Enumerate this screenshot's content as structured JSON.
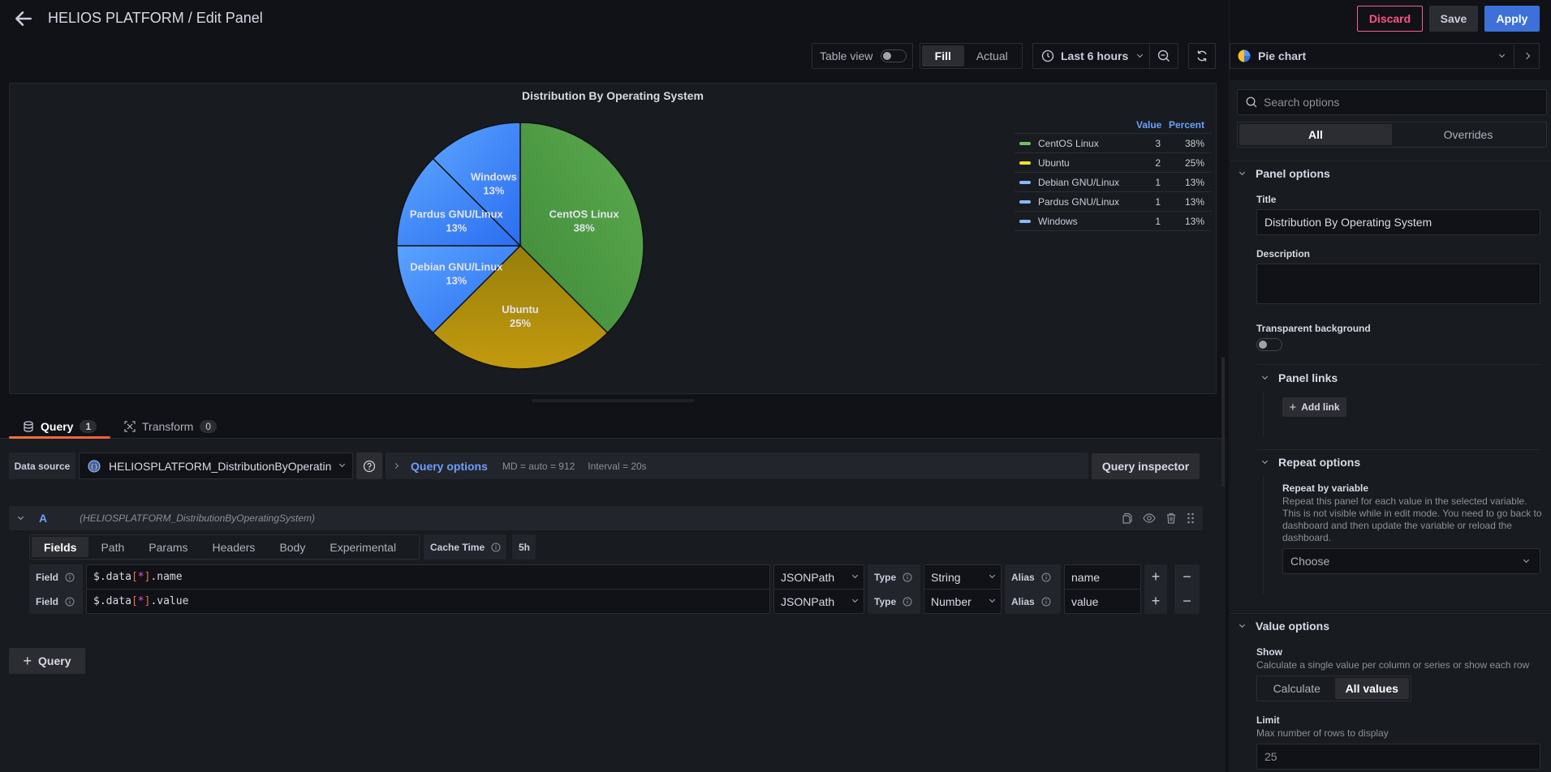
{
  "header": {
    "title": "HELIOS PLATFORM / Edit Panel",
    "discard_label": "Discard",
    "save_label": "Save",
    "apply_label": "Apply"
  },
  "toolbar": {
    "table_view_label": "Table view",
    "table_view_on": false,
    "fill_label": "Fill",
    "actual_label": "Actual",
    "fill_mode_selected": "Fill",
    "time_range": "Last 6 hours",
    "visualization": "Pie chart"
  },
  "panel": {
    "title": "Distribution By Operating System",
    "legend": {
      "value_header": "Value",
      "percent_header": "Percent"
    }
  },
  "chart_data": {
    "type": "pie",
    "title": "Distribution By Operating System",
    "legend_placement": "right",
    "slices": [
      {
        "name": "CentOS Linux",
        "value": 3,
        "percent": "38%",
        "color": "#56a64b"
      },
      {
        "name": "Ubuntu",
        "value": 2,
        "percent": "25%",
        "color": "#c49c0c"
      },
      {
        "name": "Debian GNU/Linux",
        "value": 1,
        "percent": "13%",
        "color": "#5794f2"
      },
      {
        "name": "Pardus GNU/Linux",
        "value": 1,
        "percent": "13%",
        "color": "#5794f2"
      },
      {
        "name": "Windows",
        "value": 1,
        "percent": "13%",
        "color": "#5794f2"
      }
    ]
  },
  "query_tabs": [
    {
      "label": "Query",
      "count": "1"
    },
    {
      "label": "Transform",
      "count": "0"
    }
  ],
  "datasource": {
    "label": "Data source",
    "value": "HELIOSPLATFORM_DistributionByOperatin",
    "query_options_label": "Query options",
    "md": "MD = auto = 912",
    "interval": "Interval = 20s",
    "inspector_label": "Query inspector"
  },
  "query": {
    "letter": "A",
    "datasource": "(HELIOSPLATFORM_DistributionByOperatingSystem)",
    "subtabs": [
      "Fields",
      "Path",
      "Params",
      "Headers",
      "Body",
      "Experimental"
    ],
    "active_subtab": "Fields",
    "cache_time_label": "Cache Time",
    "cache_time_value": "5h",
    "fields": [
      {
        "label": "Field",
        "prefix": "$.data",
        "open": "[",
        "star": "*",
        "close": "]",
        "suffix": ".name",
        "lang": "JSONPath",
        "type_label": "Type",
        "type": "String",
        "alias_label": "Alias",
        "alias": "name"
      },
      {
        "label": "Field",
        "prefix": "$.data",
        "open": "[",
        "star": "*",
        "close": "]",
        "suffix": ".value",
        "lang": "JSONPath",
        "type_label": "Type",
        "type": "Number",
        "alias_label": "Alias",
        "alias": "value"
      }
    ],
    "add_query_label": "Query"
  },
  "options": {
    "search_placeholder": "Search options",
    "tab_all": "All",
    "tab_overrides": "Overrides",
    "panel_options": {
      "heading": "Panel options",
      "title_label": "Title",
      "title_value": "Distribution By Operating System",
      "description_label": "Description",
      "description_value": "",
      "transparent_label": "Transparent background",
      "transparent_on": false
    },
    "panel_links": {
      "heading": "Panel links",
      "add_link_label": "Add link"
    },
    "repeat_options": {
      "heading": "Repeat options",
      "label": "Repeat by variable",
      "description": "Repeat this panel for each value in the selected variable. This is not visible while in edit mode. You need to go back to dashboard and then update the variable or reload the dashboard.",
      "placeholder": "Choose"
    },
    "value_options": {
      "heading": "Value options",
      "show_label": "Show",
      "show_description": "Calculate a single value per column or series or show each row",
      "calculate_label": "Calculate",
      "all_values_label": "All values",
      "selected": "All values",
      "limit_label": "Limit",
      "limit_description": "Max number of rows to display",
      "limit_placeholder": "25"
    }
  }
}
